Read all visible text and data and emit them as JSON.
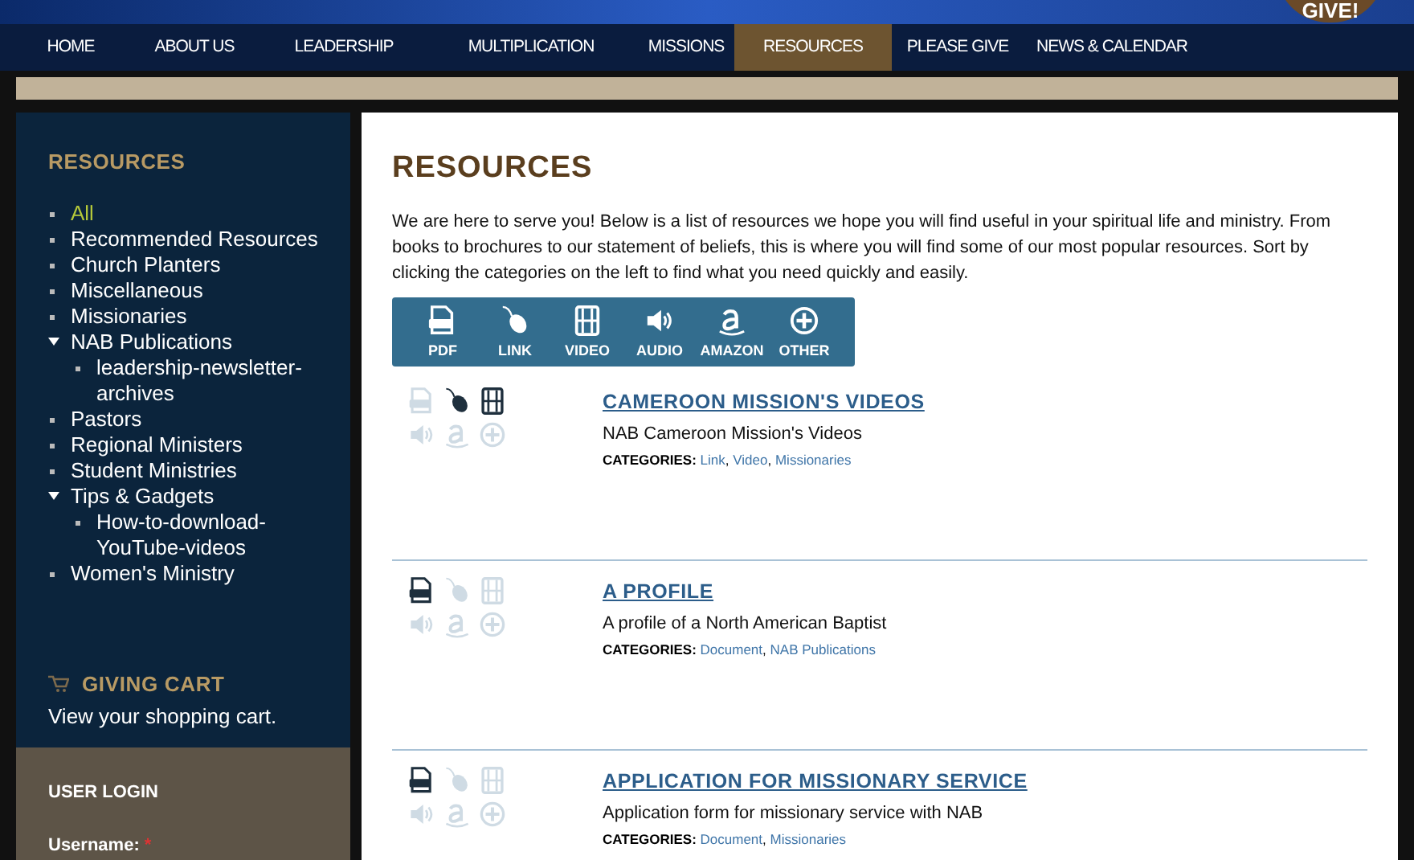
{
  "banner": {
    "badge": "GIVE!"
  },
  "nav": [
    {
      "label": "HOME",
      "selected": false
    },
    {
      "label": "ABOUT US",
      "selected": false
    },
    {
      "label": "LEADERSHIP",
      "selected": false
    },
    {
      "label": "MULTIPLICATION",
      "selected": false
    },
    {
      "label": "MISSIONS",
      "selected": false
    },
    {
      "label": "RESOURCES",
      "selected": true
    },
    {
      "label": "PLEASE GIVE",
      "selected": false
    },
    {
      "label": "NEWS & CALENDAR",
      "selected": false
    }
  ],
  "sidebar": {
    "title": "RESOURCES",
    "items": [
      {
        "label": "All",
        "selected": true
      },
      {
        "label": "Recommended Resources",
        "selected": false
      },
      {
        "label": "Church Planters",
        "selected": false
      },
      {
        "label": "Miscellaneous",
        "selected": false
      },
      {
        "label": "Missionaries",
        "selected": false
      },
      {
        "label": "NAB Publications",
        "selected": false,
        "expanded": true,
        "children": [
          {
            "label": "leadership-newsletter-archives",
            "selected": false
          }
        ]
      },
      {
        "label": "Pastors",
        "selected": false
      },
      {
        "label": "Regional Ministers",
        "selected": false
      },
      {
        "label": "Student Ministries",
        "selected": false
      },
      {
        "label": "Tips & Gadgets",
        "selected": false,
        "expanded": true,
        "children": [
          {
            "label": "How-to-download-YouTube-videos",
            "selected": false
          }
        ]
      },
      {
        "label": "Women's Ministry",
        "selected": false
      }
    ],
    "cart": {
      "title": "GIVING CART",
      "text": "View your shopping cart."
    },
    "login": {
      "title": "USER LOGIN",
      "username_label": "Username:",
      "required_mark": "*"
    }
  },
  "main": {
    "title": "RESOURCES",
    "intro": "We are here to serve you! Below is a list of resources we hope you will find useful in your spiritual life and ministry. From books to brochures to our statement of beliefs, this is where you will find some of our most popular resources. Sort by clicking the categories on the left to find what you need quickly and easily.",
    "filters": [
      {
        "kind": "pdf",
        "label": "PDF"
      },
      {
        "kind": "link",
        "label": "LINK"
      },
      {
        "kind": "video",
        "label": "VIDEO"
      },
      {
        "kind": "audio",
        "label": "AUDIO"
      },
      {
        "kind": "amazon",
        "label": "AMAZON"
      },
      {
        "kind": "other",
        "label": "OTHER"
      }
    ],
    "resources": [
      {
        "title": "CAMEROON MISSION'S VIDEOS",
        "description": "NAB Cameroon Mission's Videos",
        "categories_label": "CATEGORIES:",
        "separator": ",",
        "categories": [
          "Link",
          "Video",
          "Missionaries"
        ],
        "types": [
          {
            "kind": "pdf",
            "on": false
          },
          {
            "kind": "link",
            "on": true
          },
          {
            "kind": "video",
            "on": true
          },
          {
            "kind": "audio",
            "on": false
          },
          {
            "kind": "amazon",
            "on": false
          },
          {
            "kind": "other",
            "on": false
          }
        ]
      },
      {
        "title": "A PROFILE",
        "description": "A profile of a North American Baptist",
        "categories_label": "CATEGORIES:",
        "separator": ",",
        "categories": [
          "Document",
          "NAB Publications"
        ],
        "types": [
          {
            "kind": "pdf",
            "on": true
          },
          {
            "kind": "link",
            "on": false
          },
          {
            "kind": "video",
            "on": false
          },
          {
            "kind": "audio",
            "on": false
          },
          {
            "kind": "amazon",
            "on": false
          },
          {
            "kind": "other",
            "on": false
          }
        ]
      },
      {
        "title": "APPLICATION FOR MISSIONARY SERVICE",
        "description": "Application form for missionary service with NAB",
        "categories_label": "CATEGORIES:",
        "separator": ",",
        "categories": [
          "Document",
          "Missionaries"
        ],
        "types": [
          {
            "kind": "pdf",
            "on": true
          },
          {
            "kind": "link",
            "on": false
          },
          {
            "kind": "video",
            "on": false
          },
          {
            "kind": "audio",
            "on": false
          },
          {
            "kind": "amazon",
            "on": false
          },
          {
            "kind": "other",
            "on": false
          }
        ]
      }
    ]
  }
}
